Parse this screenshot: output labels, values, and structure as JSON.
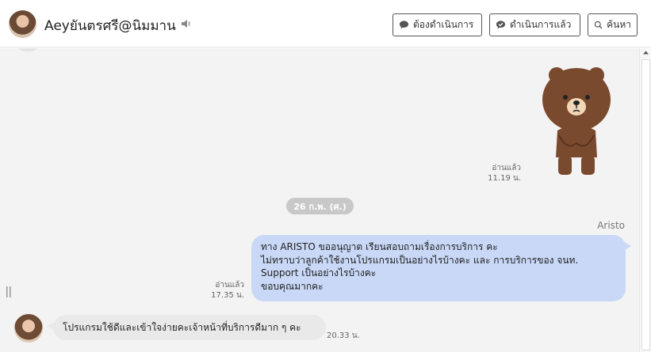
{
  "header": {
    "contact_name": "Aeyยันตรศรี@นิมมาน",
    "buttons": {
      "need_action": "ต้องดำเนินการ",
      "done": "ดำเนินการแล้ว",
      "search": "ค้นหา"
    }
  },
  "messages": [
    {
      "type": "sticker",
      "direction": "outgoing",
      "sticker": "brown-bear-sticker",
      "read_label": "อ่านแล้ว",
      "time": "11.19 น."
    },
    {
      "type": "date",
      "label": "26 ก.พ. (ศ.)"
    },
    {
      "type": "text",
      "direction": "outgoing",
      "sender": "Aristo",
      "lines": [
        "ทาง ARISTO ขออนุญาต เรียนสอบถามเรื่องการบริการ คะ",
        "ไม่ทราบว่าลูกค้าใช้งานโปรแกรมเป็นอย่างไรบ้างคะ และ การบริการของ จนท.",
        "Support เป็นอย่างไรบ้างคะ",
        "ขอบคุณมากคะ"
      ],
      "read_label": "อ่านแล้ว",
      "time": "17.35 น."
    },
    {
      "type": "text",
      "direction": "incoming",
      "text": "โปรแกรมใช้ดีและเข้าใจง่ายคะเจ้าหน้าที่บริการดีมาก ๆ คะ",
      "time": "20.33 น."
    }
  ],
  "colors": {
    "outgoing_bubble": "#c8d8f6",
    "incoming_bubble": "#e9e9e9",
    "chat_bg": "#f3f3f3",
    "date_pill": "#c8c8c8"
  },
  "icons": [
    "speaker-icon",
    "chat-bubble-icon",
    "chat-check-icon",
    "search-icon",
    "scroll-up-icon",
    "resize-handle-icon"
  ]
}
